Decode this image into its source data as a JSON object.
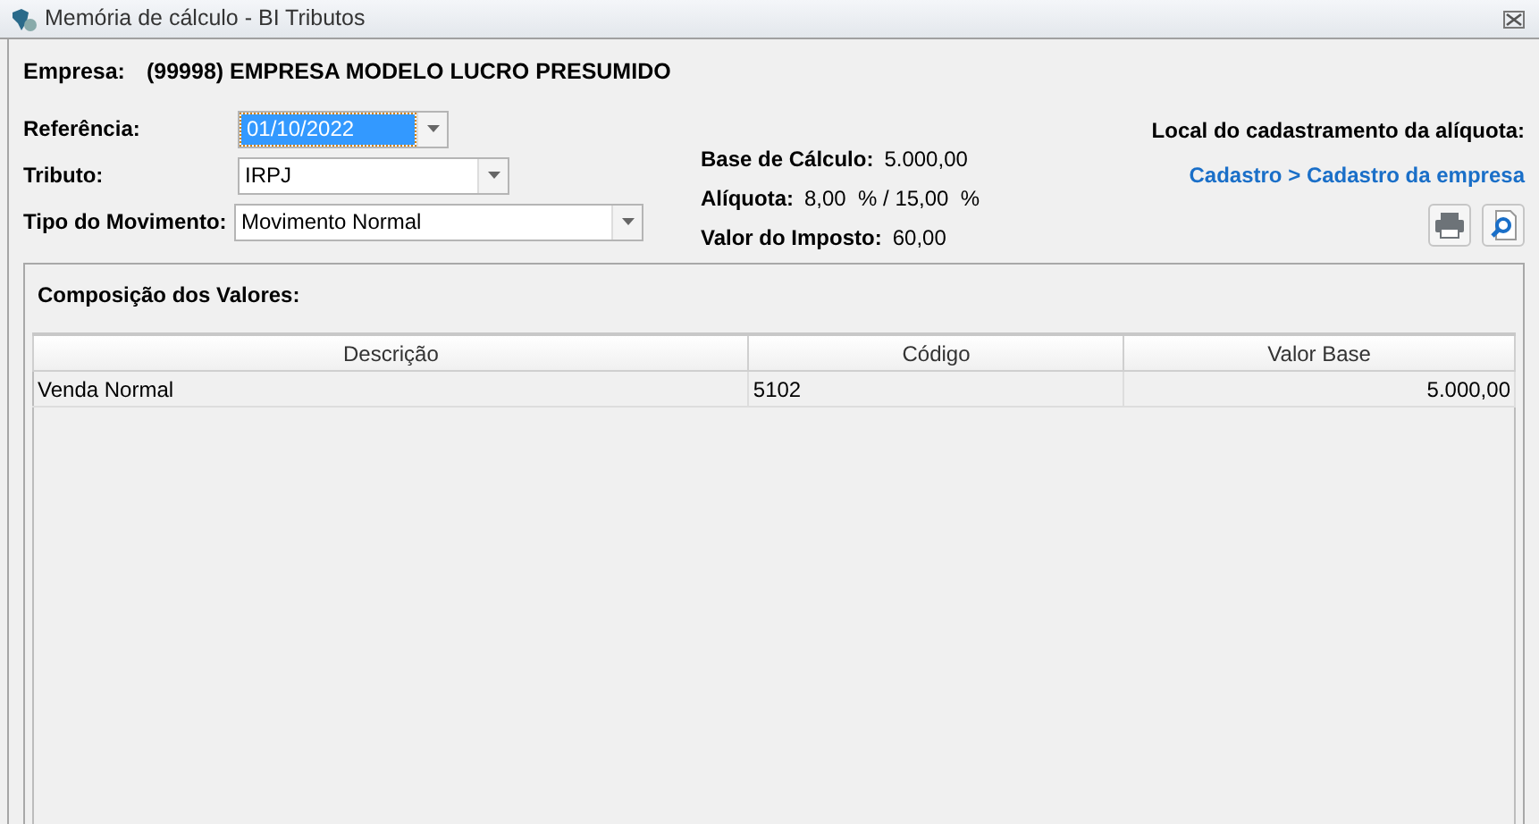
{
  "window": {
    "title": "Memória de cálculo - BI Tributos"
  },
  "company": {
    "label": "Empresa:",
    "value": "(99998) EMPRESA MODELO LUCRO PRESUMIDO"
  },
  "fields": [
    {
      "label": "Referência:",
      "value": "01/10/2022",
      "focused": true
    },
    {
      "label": "Tributo:",
      "value": "IRPJ",
      "focused": false
    },
    {
      "label": "Tipo do Movimento:",
      "value": "Movimento Normal",
      "focused": false
    }
  ],
  "summary": [
    {
      "label": "Base de Cálculo:",
      "value": "5.000,00"
    },
    {
      "label": "Alíquota:",
      "value": "8,00  % / 15,00  %"
    },
    {
      "label": "Valor do Imposto:",
      "value": "60,00"
    }
  ],
  "location": {
    "label": "Local do cadastramento da alíquota:",
    "link": "Cadastro > Cadastro da empresa"
  },
  "panel": {
    "title": "Composição dos Valores:",
    "table": {
      "columns": [
        "Descrição",
        "Código",
        "Valor Base"
      ],
      "rows": [
        [
          "Venda Normal",
          "5102",
          "5.000,00"
        ]
      ]
    }
  }
}
